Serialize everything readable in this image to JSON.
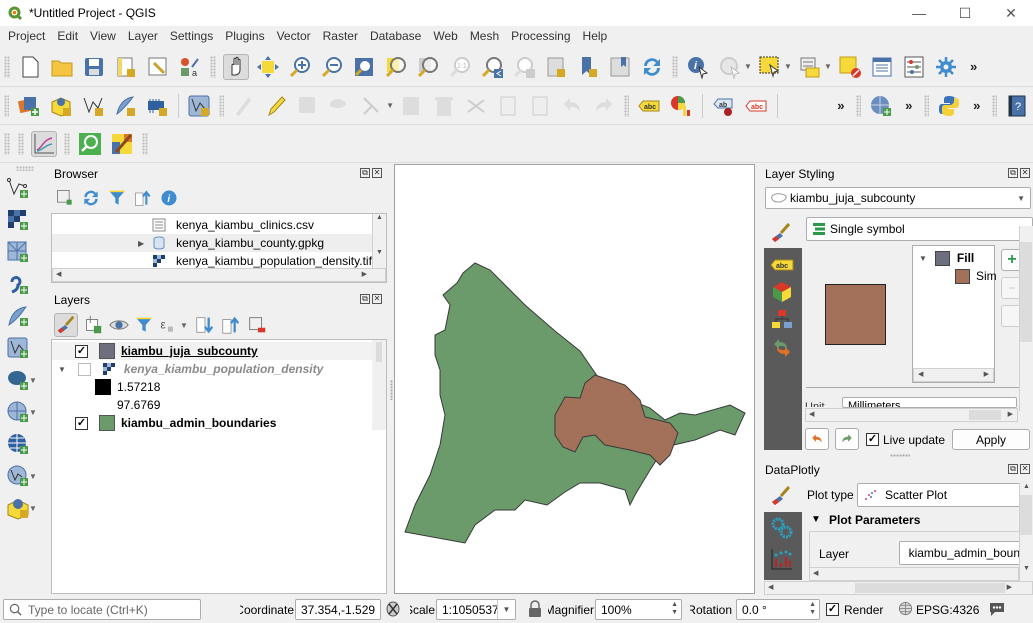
{
  "window": {
    "title": "*Untitled Project - QGIS",
    "controls": {
      "minimize": "—",
      "maximize": "☐",
      "close": "✕"
    }
  },
  "menubar": [
    "Project",
    "Edit",
    "View",
    "Layer",
    "Settings",
    "Plugins",
    "Vector",
    "Raster",
    "Database",
    "Web",
    "Mesh",
    "Processing",
    "Help"
  ],
  "toolbars": {
    "row1": [
      "new-project-icon",
      "open-project-icon",
      "save-project-icon",
      "new-print-layout-icon",
      "layout-manager-icon",
      "style-manager-icon",
      "pan-icon",
      "pan-to-selection-icon",
      "zoom-in-icon",
      "zoom-out-icon",
      "zoom-full-icon",
      "zoom-to-selection-icon",
      "zoom-to-layer-icon",
      "zoom-native-icon",
      "zoom-last-icon",
      "zoom-next-icon",
      "new-map-view-icon",
      "new-bookmark-icon",
      "show-bookmarks-icon",
      "refresh-icon",
      "identify-icon",
      "run-action-icon",
      "select-features-icon",
      "select-by-value-icon",
      "deselect-icon",
      "attribute-table-icon",
      "field-calculator-icon",
      "toolbox-icon"
    ],
    "row2": [
      "data-source-manager-icon",
      "new-geopackage-icon",
      "new-shapefile-icon",
      "new-spatialite-icon",
      "new-temp-scratch-icon",
      "new-virtual-layer-icon",
      "current-edits-icon",
      "toggle-editing-icon",
      "save-edits-icon",
      "add-polygon-icon",
      "vertex-tool-icon",
      "modify-attributes-icon",
      "delete-selected-icon",
      "cut-features-icon",
      "copy-features-icon",
      "paste-features-icon",
      "undo-icon",
      "redo-icon",
      "label-toolbar-icon",
      "diagram-icon",
      "pin-labels-icon",
      "show-hide-labels-icon",
      "metasearch-icon",
      "python-console-icon",
      "help-icon"
    ],
    "row3": [
      "dataplotly-icon",
      "locator-icon",
      "processing-history-icon"
    ],
    "more": "»"
  },
  "left_toolbar": [
    "add-vector-layer-icon",
    "add-raster-layer-icon",
    "add-mesh-layer-icon",
    "add-delimited-text-icon",
    "add-spatialite-icon",
    "add-virtual-layer-icon",
    "add-postgis-icon",
    "add-wms-icon",
    "add-xyz-icon",
    "add-wfs-icon",
    "add-arcgis-icon"
  ],
  "browser": {
    "title": "Browser",
    "items": [
      {
        "label": "kenya_kiambu_clinics.csv",
        "icon": "csv-file-icon",
        "expandable": false
      },
      {
        "label": "kenya_kiambu_county.gpkg",
        "icon": "geopackage-icon",
        "expandable": true
      },
      {
        "label": "kenya_kiambu_population_density.tif",
        "icon": "raster-file-icon",
        "expandable": false
      }
    ]
  },
  "layers": {
    "title": "Layers",
    "items": [
      {
        "label": "kiambu_juja_subcounty",
        "checked": true,
        "swatch": "#6d6e7e",
        "selected": true
      },
      {
        "label": "kenya_kiambu_population_density",
        "checked": false,
        "expanded": true,
        "legend": [
          "1.57218",
          "97.6769"
        ]
      },
      {
        "label": "kiambu_admin_boundaries",
        "checked": true,
        "swatch": "#6b9a6b"
      }
    ]
  },
  "map": {
    "colors": {
      "admin": "#6b9a6b",
      "juja": "#a3705a",
      "stroke": "#3a3a3a"
    }
  },
  "layer_styling": {
    "title": "Layer Styling",
    "layer": "kiambu_juja_subcounty",
    "renderer": "Single symbol",
    "symbol_tree": {
      "fill": "Fill",
      "simple": "Sim"
    },
    "preview_color": "#a3705a",
    "fill_color": "#6d6e7e",
    "unit_label": "Unit",
    "unit_value": "Millimeters",
    "live_update_label": "Live update",
    "live_update": true,
    "apply_label": "Apply"
  },
  "dataplotly": {
    "title": "DataPlotly",
    "plot_type_label": "Plot type",
    "plot_type": "Scatter Plot",
    "section": "Plot Parameters",
    "layer_label": "Layer",
    "layer_value": "kiambu_admin_boun"
  },
  "statusbar": {
    "locate_placeholder": "Type to locate (Ctrl+K)",
    "coordinate_label": "Coordinate",
    "coordinate": "37.354,-1.529",
    "scale_label": "Scale",
    "scale": "1:1050537",
    "magnifier_label": "Magnifier",
    "magnifier": "100%",
    "rotation_label": "Rotation",
    "rotation": "0.0 °",
    "render_label": "Render",
    "render": true,
    "crs": "EPSG:4326"
  }
}
